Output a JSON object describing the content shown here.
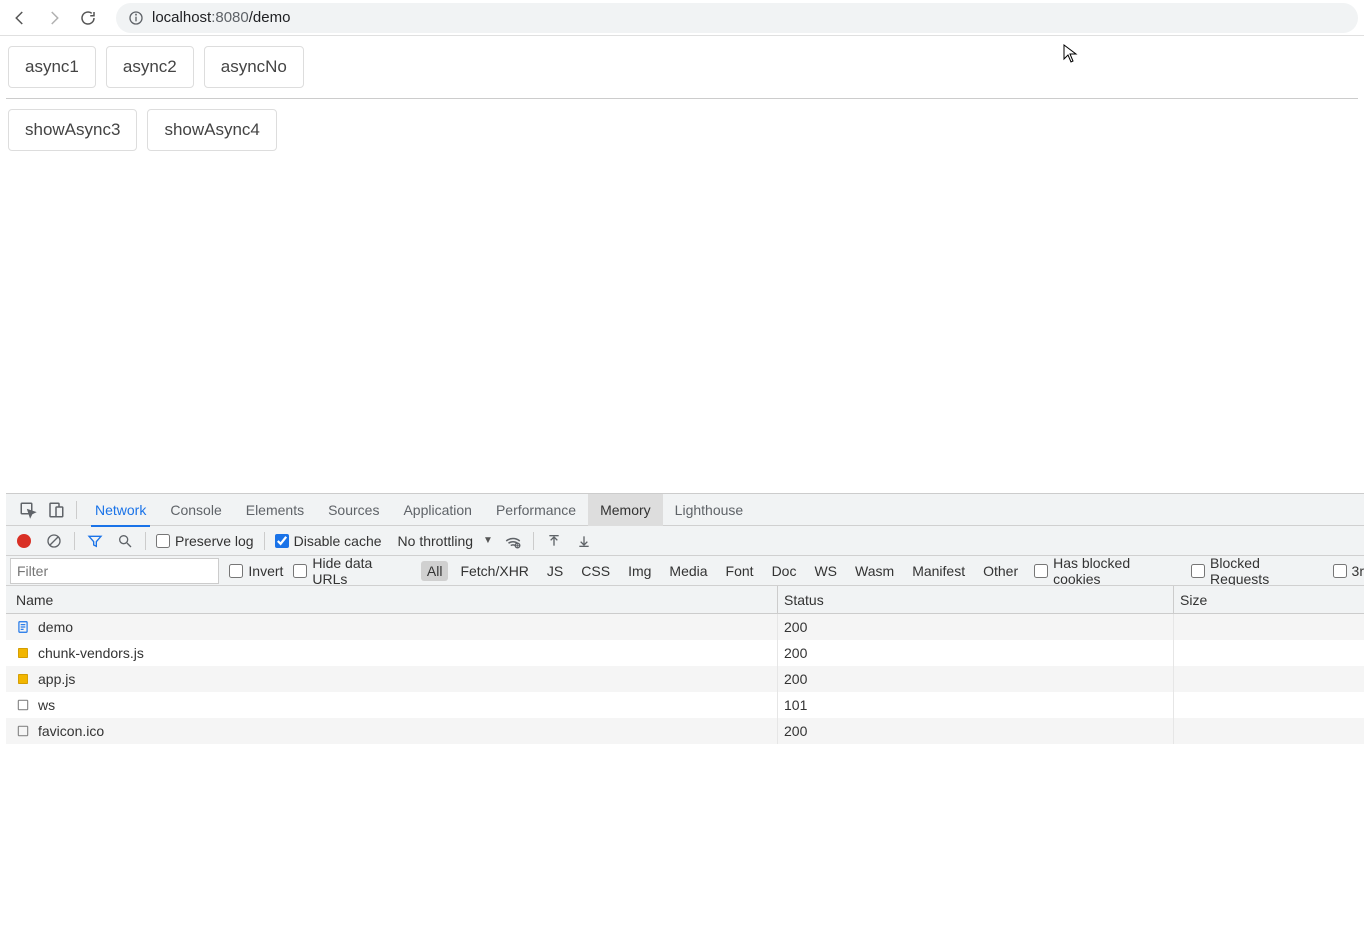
{
  "browser": {
    "url_host": "localhost",
    "url_port": ":8080",
    "url_path": "/demo"
  },
  "page": {
    "row1": [
      "async1",
      "async2",
      "asyncNo"
    ],
    "row2": [
      "showAsync3",
      "showAsync4"
    ]
  },
  "devtools": {
    "tabs": [
      "Network",
      "Console",
      "Elements",
      "Sources",
      "Application",
      "Performance",
      "Memory",
      "Lighthouse"
    ],
    "active_tab": "Network",
    "highlight_tab": "Memory",
    "toolbar": {
      "preserve_log": "Preserve log",
      "disable_cache": "Disable cache",
      "throttling": "No throttling"
    },
    "filter": {
      "placeholder": "Filter",
      "invert": "Invert",
      "hide_data_urls": "Hide data URLs",
      "types": [
        "All",
        "Fetch/XHR",
        "JS",
        "CSS",
        "Img",
        "Media",
        "Font",
        "Doc",
        "WS",
        "Wasm",
        "Manifest",
        "Other"
      ],
      "active_type": "All",
      "has_blocked_cookies": "Has blocked cookies",
      "blocked_requests": "Blocked Requests",
      "third_party": "3r"
    },
    "columns": {
      "name": "Name",
      "status": "Status",
      "size": "Size"
    },
    "requests": [
      {
        "name": "demo",
        "status": "200",
        "icon": "doc"
      },
      {
        "name": "chunk-vendors.js",
        "status": "200",
        "icon": "js"
      },
      {
        "name": "app.js",
        "status": "200",
        "icon": "js"
      },
      {
        "name": "ws",
        "status": "101",
        "icon": "ws"
      },
      {
        "name": "favicon.ico",
        "status": "200",
        "icon": "ws"
      }
    ]
  }
}
